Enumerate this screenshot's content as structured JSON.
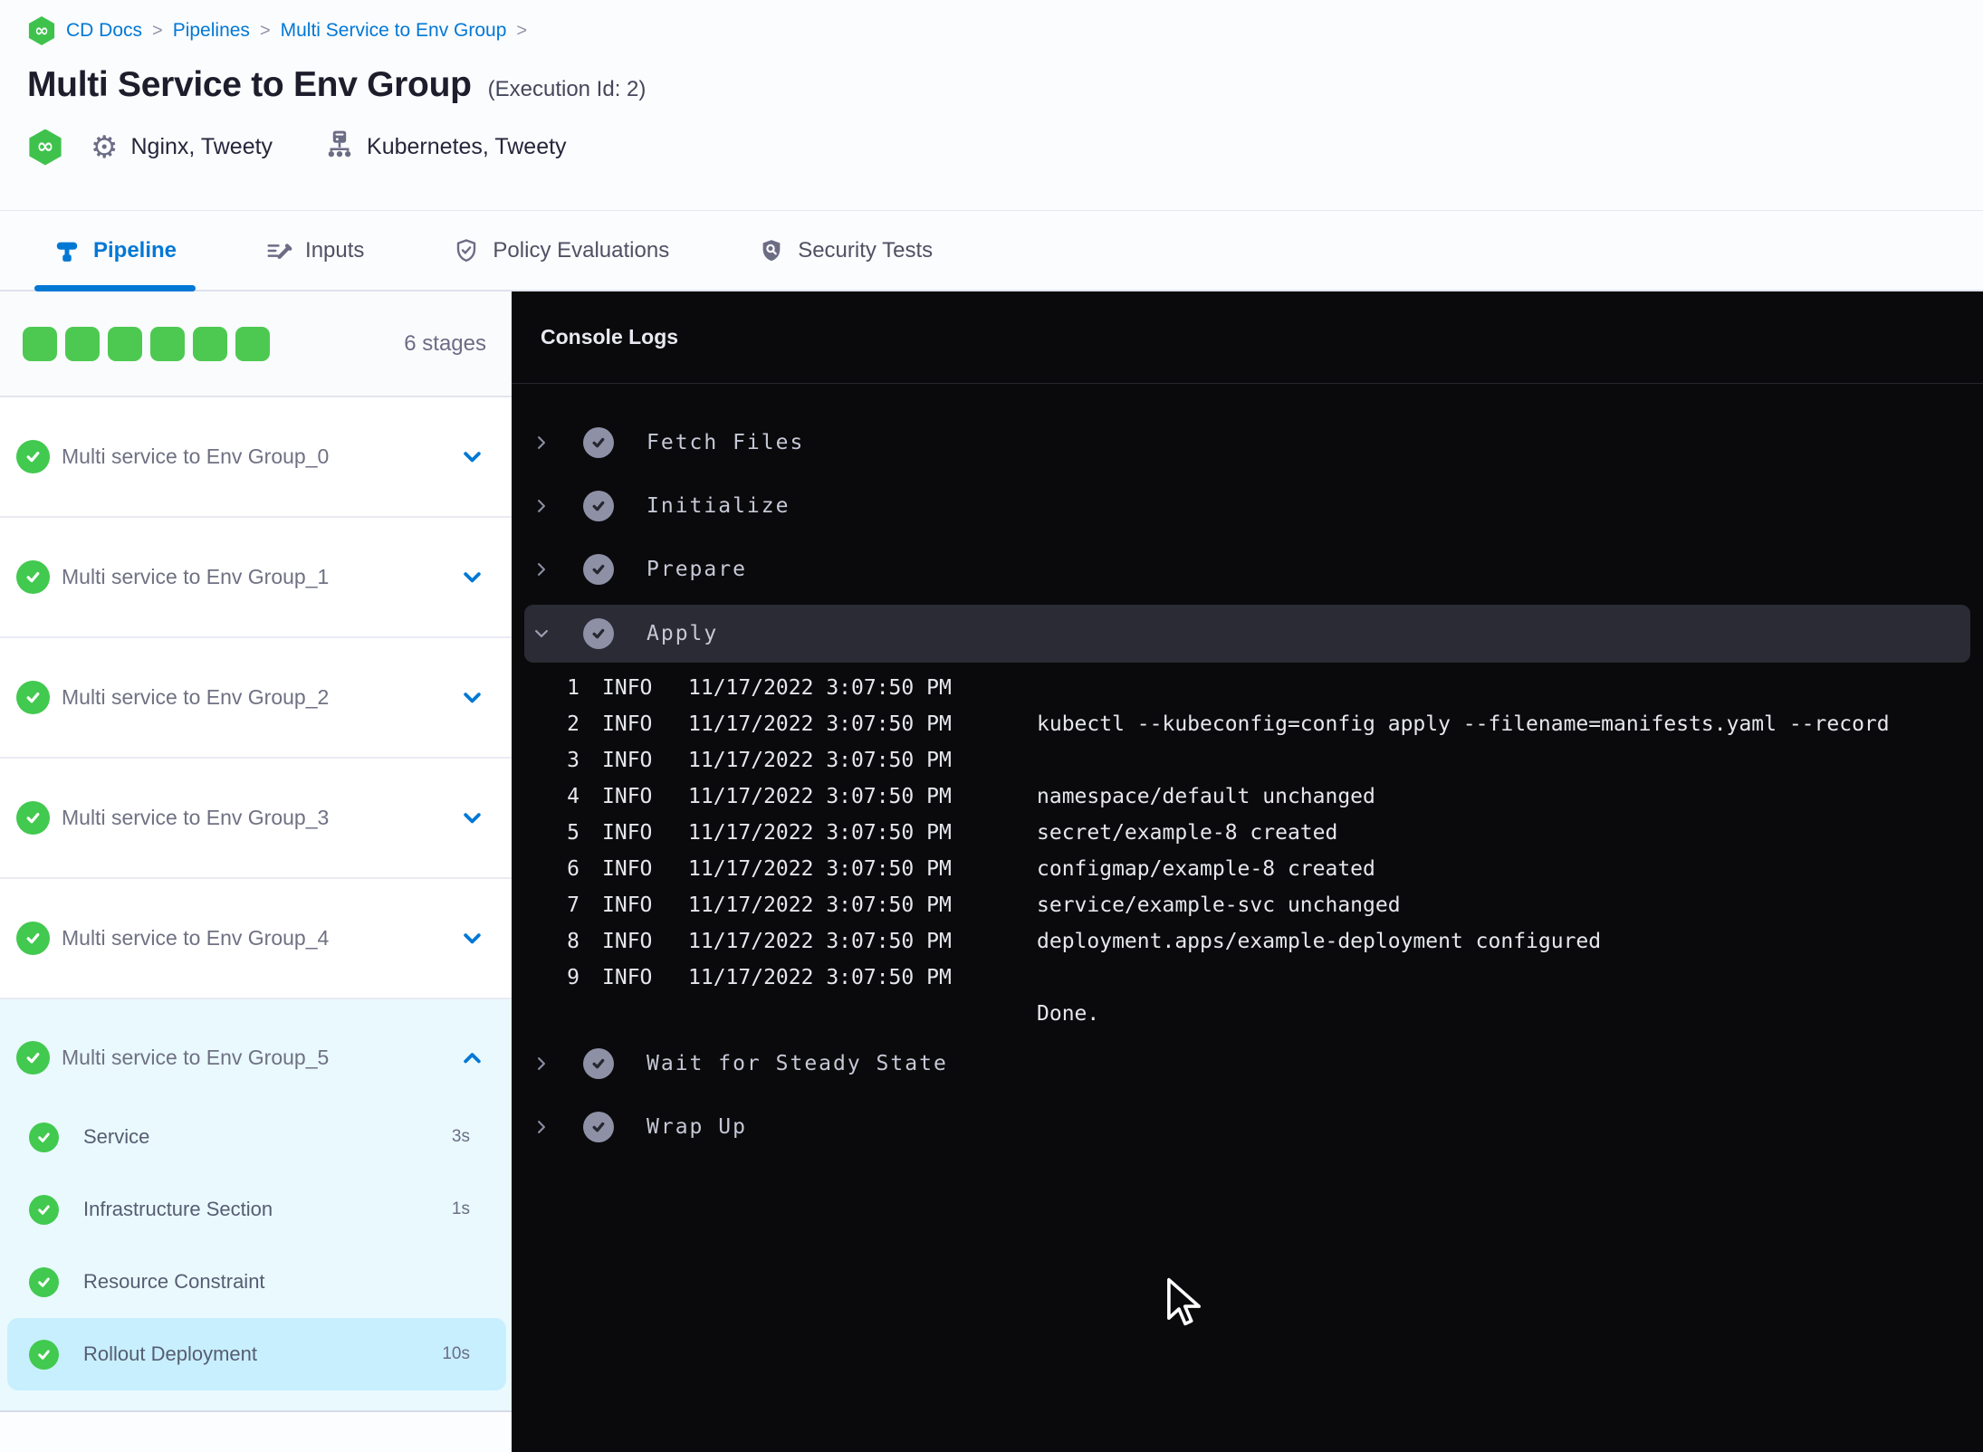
{
  "breadcrumb": {
    "separator": ">",
    "items": [
      {
        "label": "CD Docs"
      },
      {
        "label": "Pipelines"
      },
      {
        "label": "Multi Service to Env Group"
      }
    ]
  },
  "header": {
    "title": "Multi Service to Env Group",
    "execution_id": "(Execution Id: 2)",
    "services": "Nginx, Tweety",
    "environments": "Kubernetes, Tweety"
  },
  "tabs": [
    {
      "label": "Pipeline",
      "active": true
    },
    {
      "label": "Inputs",
      "active": false
    },
    {
      "label": "Policy Evaluations",
      "active": false
    },
    {
      "label": "Security Tests",
      "active": false
    }
  ],
  "sidebar": {
    "stage_count_label": "6 stages",
    "progress_square_count": 6,
    "stages": [
      {
        "label": "Multi service to Env Group_0",
        "status": "success",
        "expanded": false
      },
      {
        "label": "Multi service to Env Group_1",
        "status": "success",
        "expanded": false
      },
      {
        "label": "Multi service to Env Group_2",
        "status": "success",
        "expanded": false
      },
      {
        "label": "Multi service to Env Group_3",
        "status": "success",
        "expanded": false
      },
      {
        "label": "Multi service to Env Group_4",
        "status": "success",
        "expanded": false
      },
      {
        "label": "Multi service to Env Group_5",
        "status": "success",
        "expanded": true,
        "steps": [
          {
            "label": "Service",
            "duration": "3s",
            "selected": false
          },
          {
            "label": "Infrastructure Section",
            "duration": "1s",
            "selected": false
          },
          {
            "label": "Resource Constraint",
            "duration": "",
            "selected": false
          },
          {
            "label": "Rollout Deployment",
            "duration": "10s",
            "selected": true
          }
        ]
      }
    ]
  },
  "console": {
    "title": "Console Logs",
    "sections": [
      {
        "label": "Fetch Files",
        "expanded": false
      },
      {
        "label": "Initialize",
        "expanded": false
      },
      {
        "label": "Prepare",
        "expanded": false
      },
      {
        "label": "Apply",
        "expanded": true,
        "lines": [
          {
            "num": "1",
            "level": "INFO",
            "timestamp": "11/17/2022 3:07:50 PM",
            "message": ""
          },
          {
            "num": "2",
            "level": "INFO",
            "timestamp": "11/17/2022 3:07:50 PM",
            "message": "kubectl --kubeconfig=config apply --filename=manifests.yaml --record"
          },
          {
            "num": "3",
            "level": "INFO",
            "timestamp": "11/17/2022 3:07:50 PM",
            "message": ""
          },
          {
            "num": "4",
            "level": "INFO",
            "timestamp": "11/17/2022 3:07:50 PM",
            "message": "namespace/default unchanged"
          },
          {
            "num": "5",
            "level": "INFO",
            "timestamp": "11/17/2022 3:07:50 PM",
            "message": "secret/example-8 created"
          },
          {
            "num": "6",
            "level": "INFO",
            "timestamp": "11/17/2022 3:07:50 PM",
            "message": "configmap/example-8 created"
          },
          {
            "num": "7",
            "level": "INFO",
            "timestamp": "11/17/2022 3:07:50 PM",
            "message": "service/example-svc unchanged"
          },
          {
            "num": "8",
            "level": "INFO",
            "timestamp": "11/17/2022 3:07:50 PM",
            "message": "deployment.apps/example-deployment configured"
          },
          {
            "num": "9",
            "level": "INFO",
            "timestamp": "11/17/2022 3:07:50 PM",
            "message": ""
          },
          {
            "num": "",
            "level": "",
            "timestamp": "",
            "message": "Done."
          }
        ]
      },
      {
        "label": "Wait for Steady State",
        "expanded": false
      },
      {
        "label": "Wrap Up",
        "expanded": false
      }
    ]
  },
  "icons": {
    "module": "infinity-hexagon",
    "infinity_glyph": "∞",
    "gear_glyph": "⚙"
  },
  "colors": {
    "accent_blue": "#0278d5",
    "success_green": "#4dc952",
    "console_bg": "#0a0a0c",
    "expanded_stage_bg": "#e9f9fe",
    "selected_step_bg": "#c8effd"
  }
}
